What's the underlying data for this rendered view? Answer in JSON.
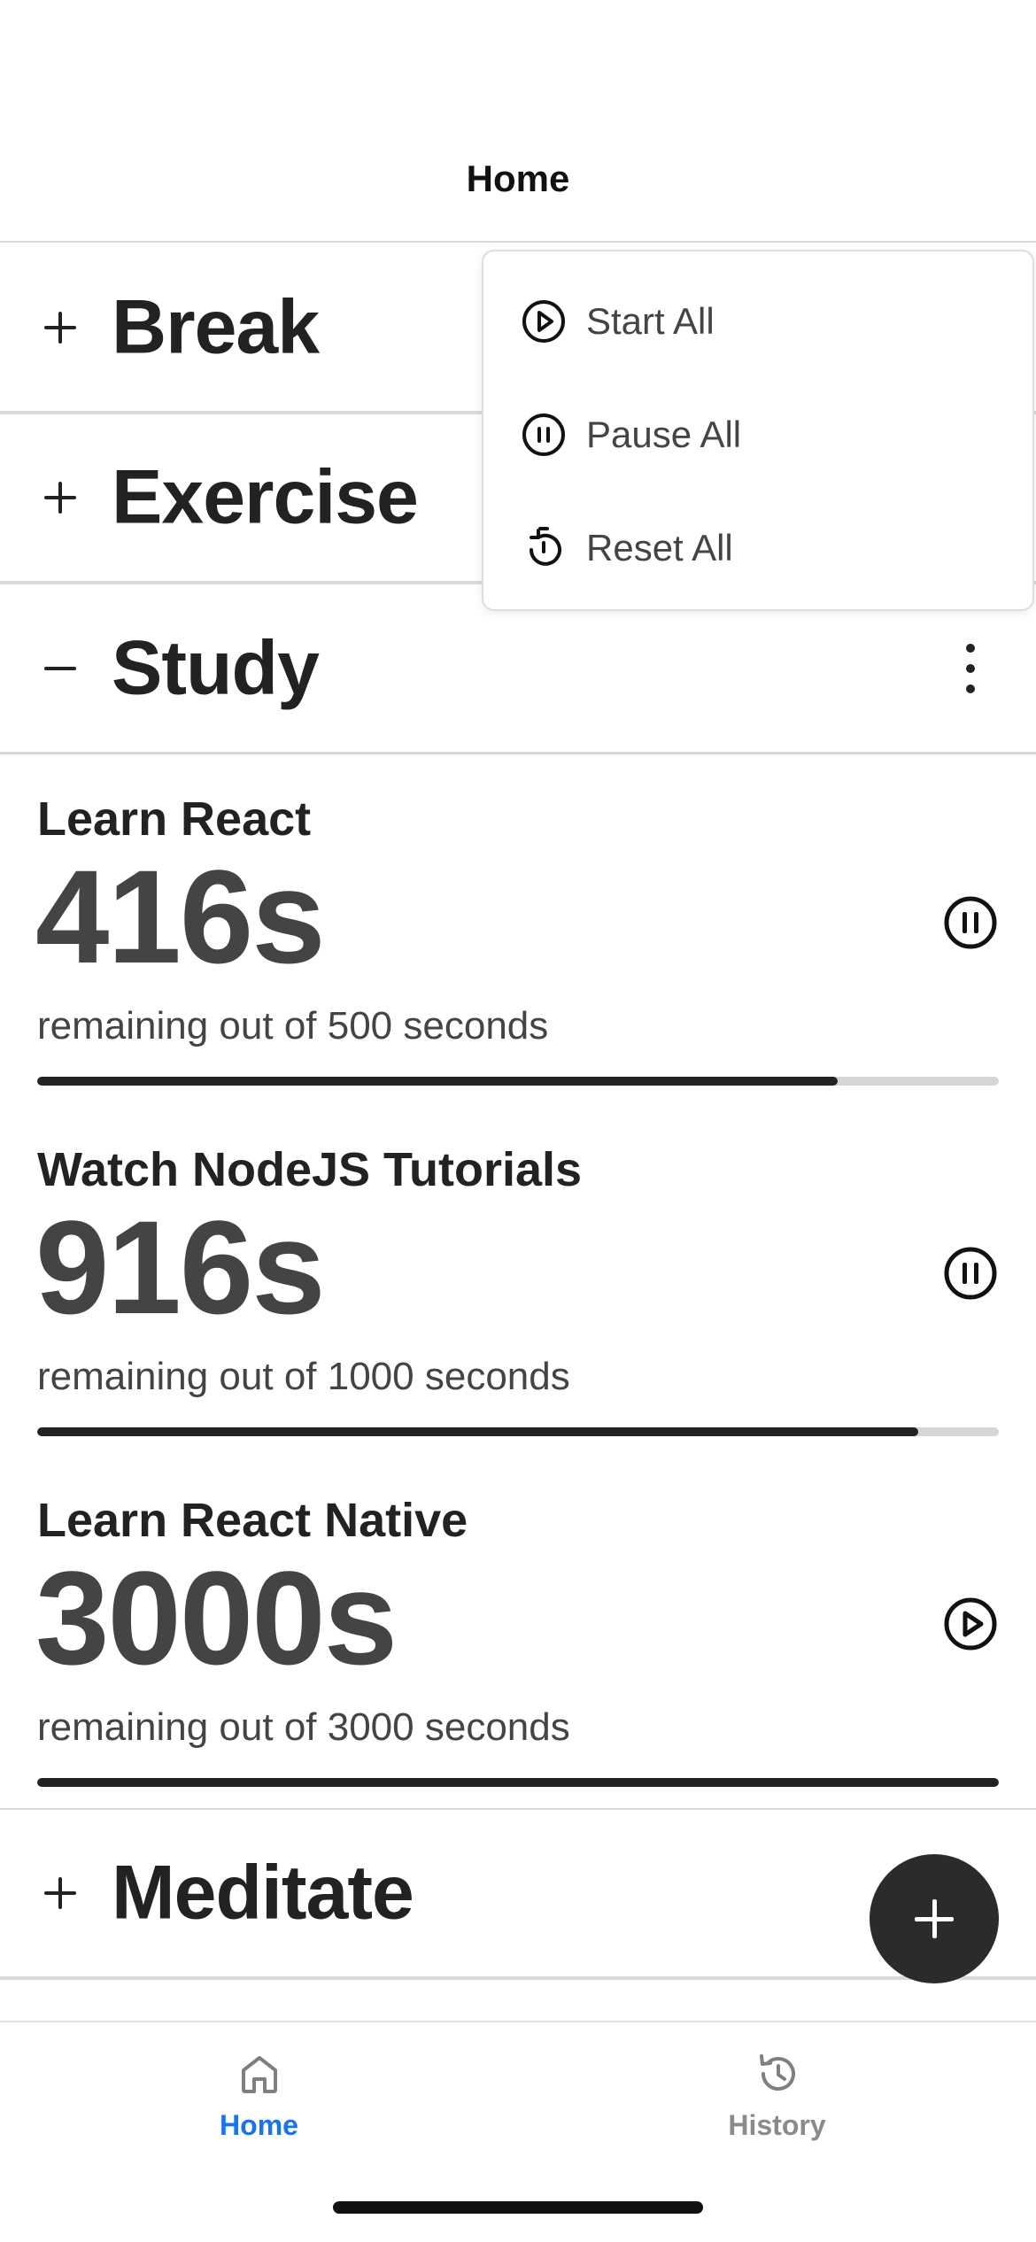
{
  "header": {
    "title": "Home"
  },
  "categories": {
    "break": {
      "name": "Break"
    },
    "exercise": {
      "name": "Exercise"
    },
    "study": {
      "name": "Study"
    },
    "meditate": {
      "name": "Meditate"
    }
  },
  "timers": [
    {
      "name": "Learn React",
      "value": "416s",
      "subtitle": "remaining out of 500 seconds",
      "progress": 0.832,
      "state_icon": "pause-icon"
    },
    {
      "name": "Watch NodeJS Tutorials",
      "value": "916s",
      "subtitle": "remaining out of 1000 seconds",
      "progress": 0.916,
      "state_icon": "pause-icon"
    },
    {
      "name": "Learn React Native",
      "value": "3000s",
      "subtitle": "remaining out of 3000 seconds",
      "progress": 1.0,
      "state_icon": "play-icon"
    }
  ],
  "menu": {
    "items": [
      {
        "label": "Start All",
        "icon": "play-circle-icon"
      },
      {
        "label": "Pause All",
        "icon": "pause-circle-icon"
      },
      {
        "label": "Reset All",
        "icon": "reset-timer-icon"
      }
    ]
  },
  "tabbar": {
    "tabs": [
      {
        "label": "Home",
        "icon": "home-icon",
        "active": true
      },
      {
        "label": "History",
        "icon": "history-icon",
        "active": false
      }
    ]
  },
  "colors": {
    "active_tab": "#1a73e8",
    "inactive_tab": "#8a8a8a",
    "fab_background": "#2b2b2b",
    "progress_fill": "#222222",
    "progress_track": "#d6d6d6"
  }
}
